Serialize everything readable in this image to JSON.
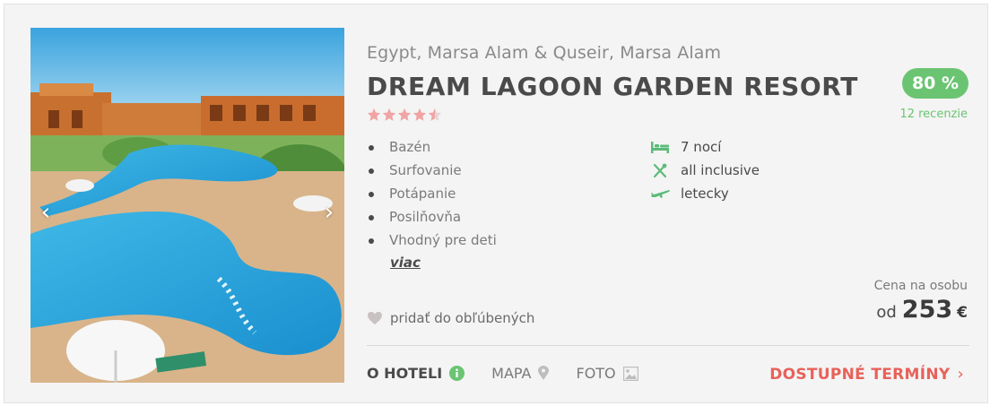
{
  "hotel": {
    "location": "Egypt, Marsa Alam & Quseir, Marsa Alam",
    "name": "DREAM LAGOON GARDEN RESORT",
    "stars": 4.5,
    "features": [
      "Bazén",
      "Surfovanie",
      "Potápanie",
      "Posilňovňa",
      "Vhodný pre deti"
    ],
    "more_label": "viac"
  },
  "trip": {
    "duration": "7 nocí",
    "board": "all inclusive",
    "transport": "letecky",
    "icons": [
      "bed-icon",
      "cutlery-icon",
      "plane-icon"
    ]
  },
  "rating": {
    "score": "80 %",
    "reviews": "12 recenzie"
  },
  "price": {
    "label": "Cena na osobu",
    "from": "od",
    "amount": "253",
    "currency": "€"
  },
  "favorite_label": "pridať do obľúbených",
  "tabs": {
    "about": "O HOTELI",
    "map": "MAPA",
    "photo": "FOTO"
  },
  "cta_label": "DOSTUPNÉ TERMÍNY",
  "gallery": {
    "prev_glyph": "‹",
    "next_glyph": "›"
  },
  "colors": {
    "accent_green": "#6bc472",
    "trip_icon_green": "#5bbb7a",
    "cta_red": "#e8615a",
    "star_pink": "#f0a4a4",
    "star_empty": "#e3d6d6"
  }
}
